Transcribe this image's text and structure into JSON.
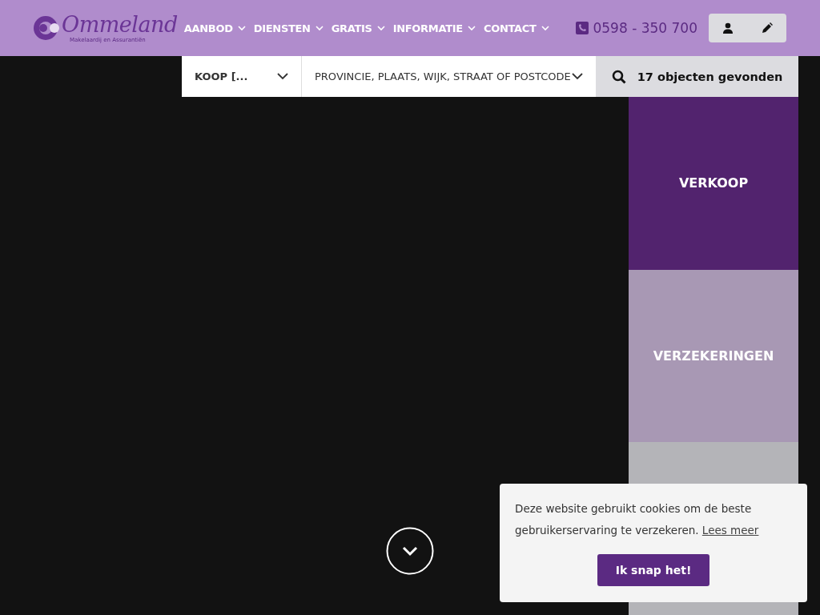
{
  "logo": {
    "name": "Ommeland",
    "tagline": "Makelaardij en Assurantiën"
  },
  "nav": [
    {
      "label": "AANBOD"
    },
    {
      "label": "DIENSTEN"
    },
    {
      "label": "GRATIS"
    },
    {
      "label": "INFORMATIE"
    },
    {
      "label": "CONTACT"
    }
  ],
  "phone": "0598 - 350 700",
  "search": {
    "type_select": "KOOP [...",
    "location_placeholder": "PROVINCIE, PLAATS, WIJK, STRAAT OF POSTCODE",
    "result_button": "17 objecten gevonden"
  },
  "tiles": [
    {
      "label": "VERKOOP"
    },
    {
      "label": "VERZEKERINGEN"
    }
  ],
  "cookie": {
    "message": "Deze website gebruikt cookies om de beste gebruikerservaring te verzekeren.",
    "link": "Lees meer",
    "button": "Ik snap het!"
  }
}
